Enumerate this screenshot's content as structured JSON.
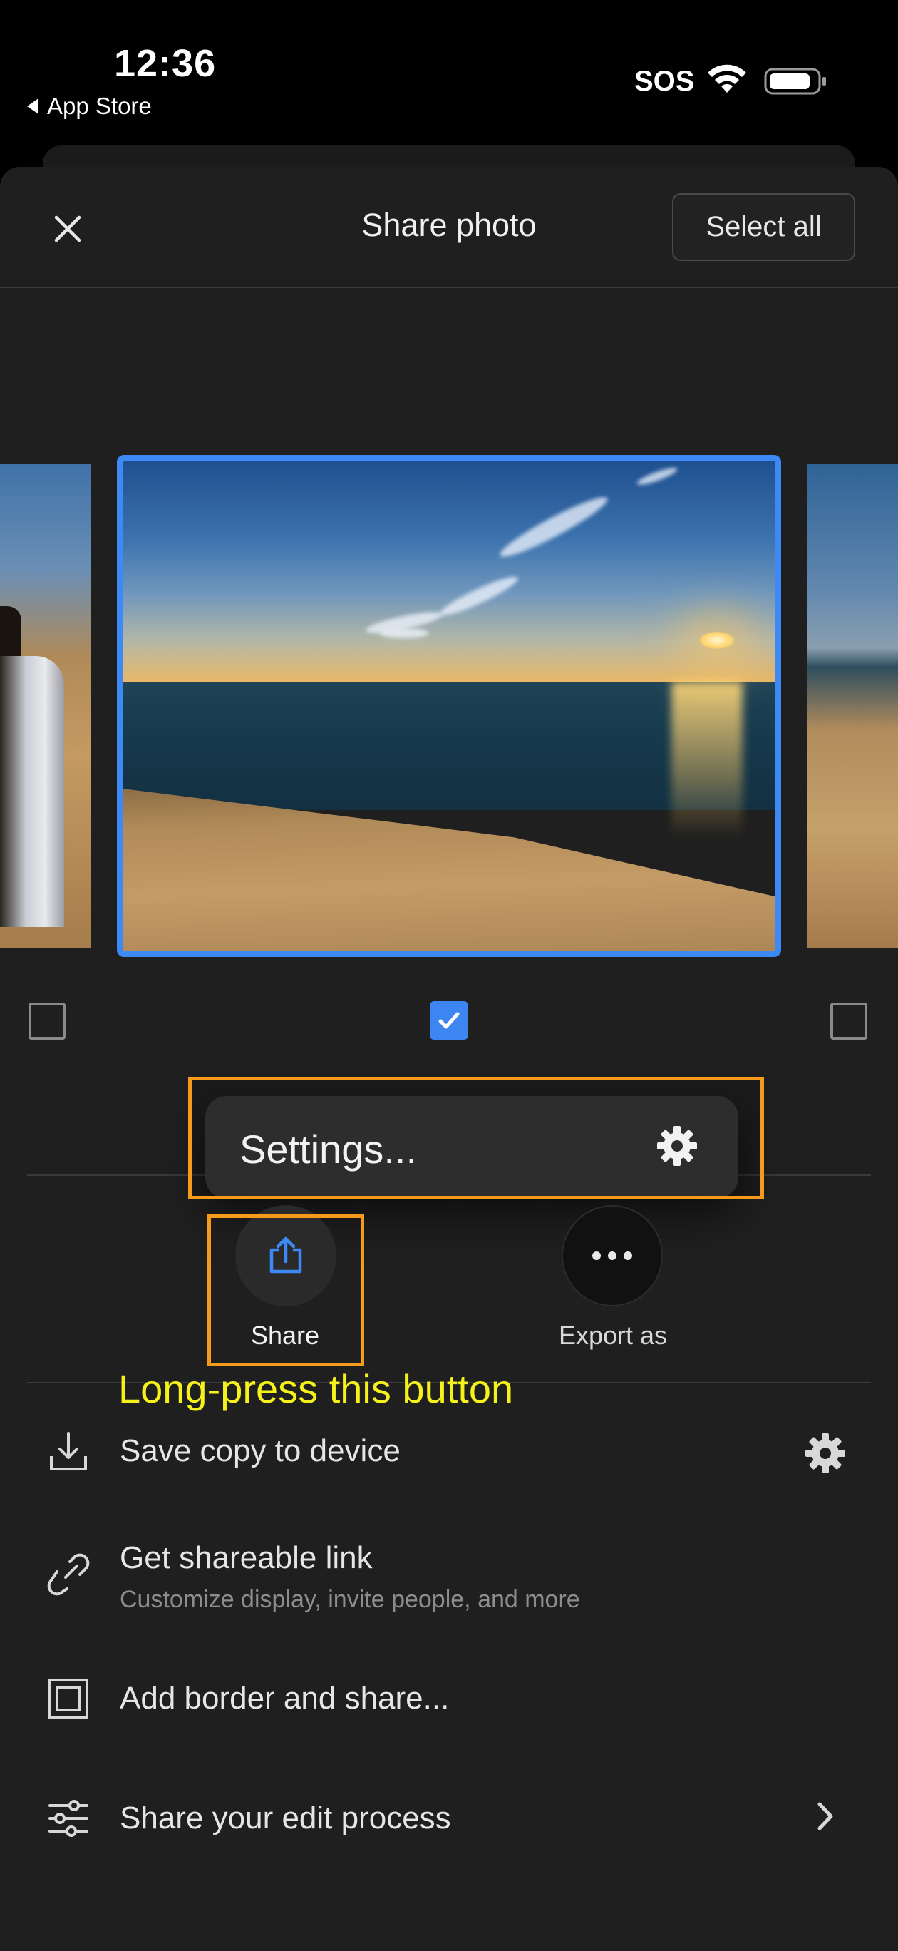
{
  "status_bar": {
    "time": "12:36",
    "back_label": "App Store",
    "carrier": "SOS",
    "icons": [
      "wifi-icon",
      "battery-icon"
    ]
  },
  "header": {
    "title": "Share photo",
    "select_all_label": "Select all",
    "close_icon": "close-icon"
  },
  "photos": [
    {
      "selected": false
    },
    {
      "selected": true
    },
    {
      "selected": false
    }
  ],
  "settings_menu": {
    "label": "Settings...",
    "icon": "gear-icon"
  },
  "actions": [
    {
      "label": "Share",
      "icon": "share-icon"
    },
    {
      "label": "Export as",
      "icon": "more-icon"
    }
  ],
  "annotation": {
    "hint": "Long-press this button"
  },
  "list": [
    {
      "title": "Save copy to device",
      "subtitle": "",
      "icon": "download-icon",
      "trailing": "gear-icon"
    },
    {
      "title": "Get shareable link",
      "subtitle": "Customize display, invite people, and more",
      "icon": "link-icon",
      "trailing": ""
    },
    {
      "title": "Add border and share...",
      "subtitle": "",
      "icon": "border-icon",
      "trailing": ""
    },
    {
      "title": "Share your edit process",
      "subtitle": "",
      "icon": "sliders-icon",
      "trailing": "chevron-right-icon"
    }
  ],
  "colors": {
    "accent": "#3d8af7",
    "highlight_box": "#f59a1a",
    "hint_text": "#f4f11b",
    "sheet_bg": "#1f1f1f"
  }
}
